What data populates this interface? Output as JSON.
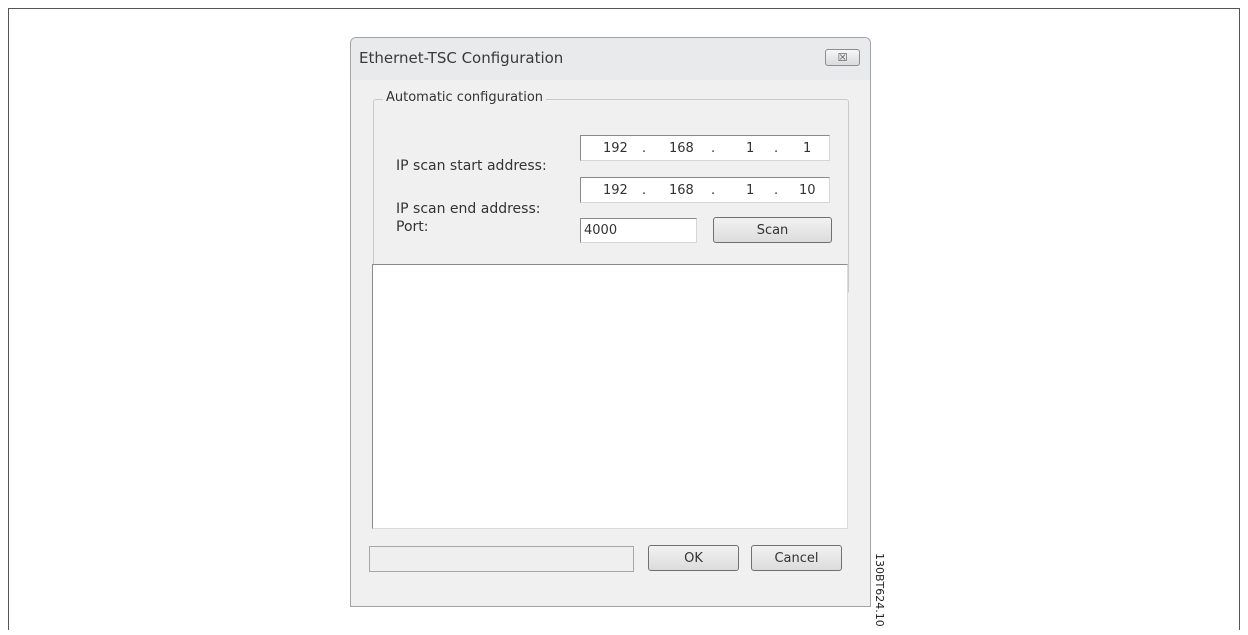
{
  "dialog": {
    "title": "Ethernet-TSC Configuration",
    "close_glyph": "☒"
  },
  "auto_config": {
    "group_label": "Automatic configuration",
    "start_label": "IP scan start address:",
    "start_ip": [
      "192",
      "168",
      "1",
      "1"
    ],
    "end_label": "IP scan end address:",
    "end_ip": [
      "192",
      "168",
      "1",
      "10"
    ],
    "port_label": "Port:",
    "port_value": "4000",
    "scan_label": "Scan"
  },
  "footer": {
    "ok_label": "OK",
    "cancel_label": "Cancel"
  },
  "figure_code": "130BT624.10"
}
